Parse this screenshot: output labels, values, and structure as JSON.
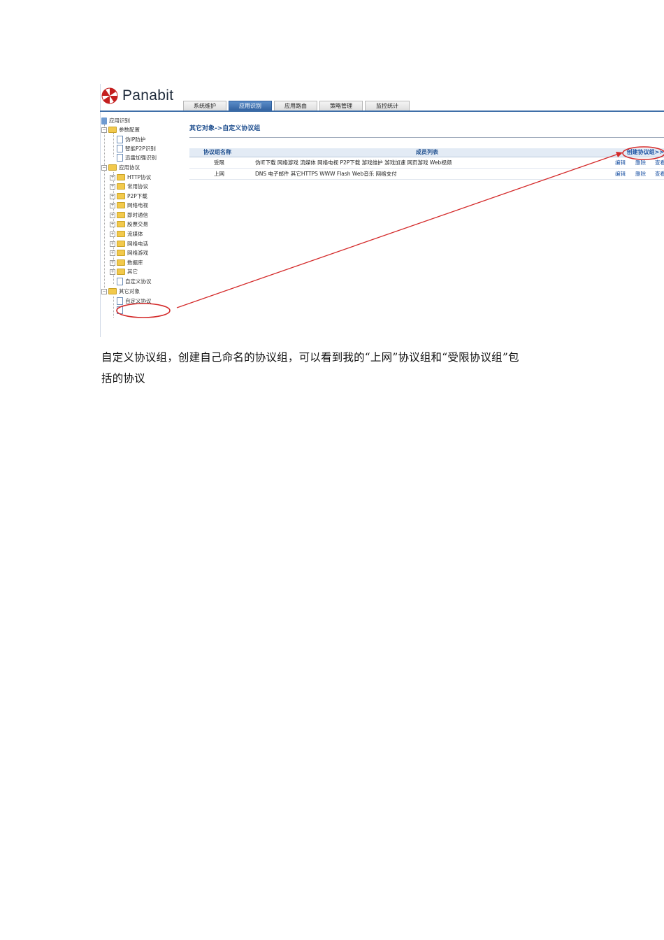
{
  "app": {
    "logo_text": "Panabit"
  },
  "tabs": [
    {
      "label": "系统维护"
    },
    {
      "label": "应用识别"
    },
    {
      "label": "应用路由"
    },
    {
      "label": "策略管理"
    },
    {
      "label": "监控统计"
    }
  ],
  "tree": {
    "root": "应用识别",
    "items": [
      {
        "label": "参数配置"
      },
      {
        "label": "伪IP防护"
      },
      {
        "label": "智能P2P识别"
      },
      {
        "label": "迅雷加强识别"
      },
      {
        "label": "应用协议"
      },
      {
        "label": "HTTP协议"
      },
      {
        "label": "常用协议"
      },
      {
        "label": "P2P下载"
      },
      {
        "label": "网络电视"
      },
      {
        "label": "即时通信"
      },
      {
        "label": "股票交易"
      },
      {
        "label": "流媒体"
      },
      {
        "label": "网络电话"
      },
      {
        "label": "网络游戏"
      },
      {
        "label": "数据库"
      },
      {
        "label": "其它"
      },
      {
        "label": "自定义协议"
      },
      {
        "label": "其它对象"
      },
      {
        "label": "自定义协议"
      },
      {
        "label": "自定义协议组"
      }
    ]
  },
  "content": {
    "breadcrumb": "其它对象->自定义协议组",
    "table": {
      "headers": {
        "name": "协议组名称",
        "members": "成员列表"
      },
      "create_link": "创建协议组>>",
      "rows": [
        {
          "name": "受限",
          "members": "伪IE下载 网络游戏 流媒体 网络电视 P2P下载 游戏维护 游戏加速 网页游戏 Web视频",
          "edit": "编辑",
          "delete": "删除",
          "more": "查看"
        },
        {
          "name": "上网",
          "members": "DNS 电子邮件 其它HTTPS WWW Flash Web音乐 网络支付",
          "edit": "编辑",
          "delete": "删除",
          "more": "查看"
        }
      ]
    }
  },
  "annotation_color": "#d42a2a",
  "caption": {
    "line1": "自定义协议组，创建自己命名的协议组，可以看到我的“上网”协议组和“受限协议组”包",
    "line2": "括的协议"
  }
}
